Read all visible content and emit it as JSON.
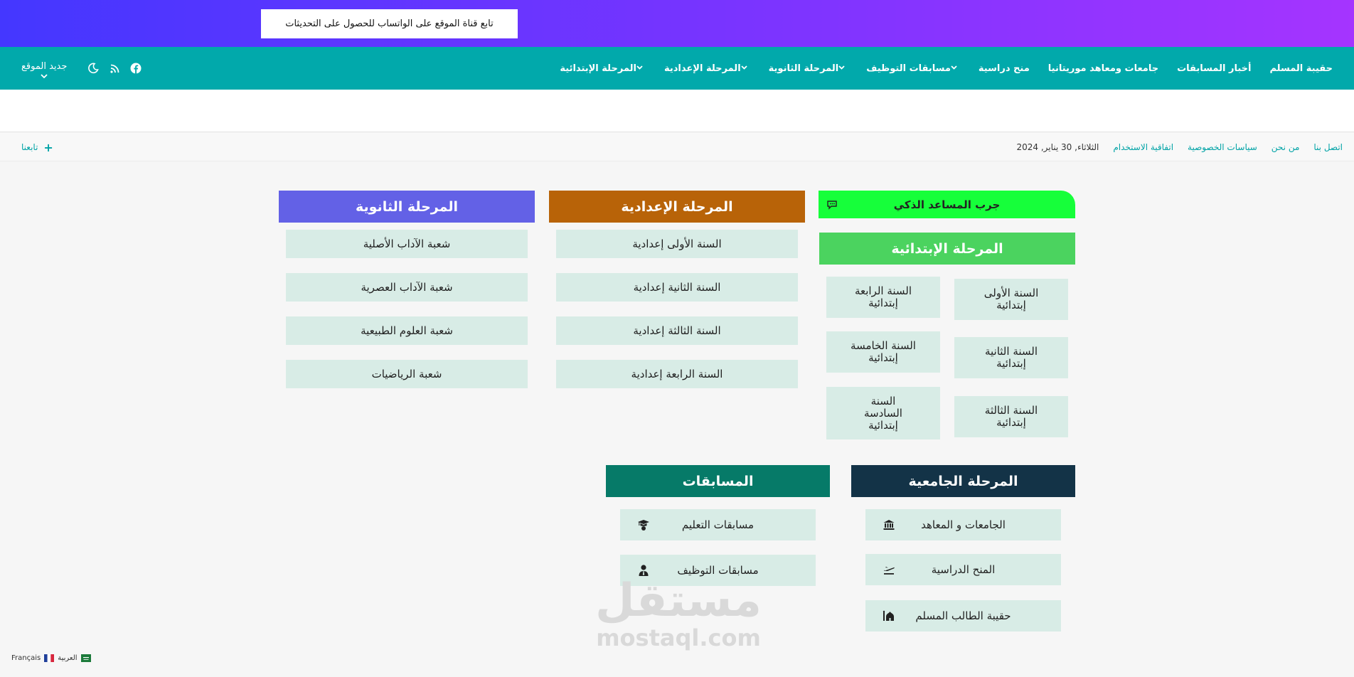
{
  "banner": {
    "whatsapp_label": "تابع قناة الموقع على الواتساب للحصول على التحديثات"
  },
  "nav": {
    "items": [
      {
        "label": "المرحلة الإبتدائية",
        "dropdown": true
      },
      {
        "label": "المرحلة الإعدادية",
        "dropdown": true
      },
      {
        "label": "المرحلة الثانوية",
        "dropdown": true
      },
      {
        "label": "مسابقات التوظيف",
        "dropdown": true
      },
      {
        "label": "منح دراسية",
        "dropdown": false
      },
      {
        "label": "جامعات ومعاهد موريتانيا",
        "dropdown": false
      },
      {
        "label": "أخبار المسابقات",
        "dropdown": false
      },
      {
        "label": "حقيبة المسلم",
        "dropdown": false
      }
    ],
    "site_new": "جديد الموقع",
    "icons": [
      "moon-icon",
      "rss-icon",
      "facebook-icon"
    ]
  },
  "subbar": {
    "date": "الثلاثاء, 30 يناير, 2024",
    "links": [
      "اتفاقية الاستخدام",
      "سياسات الخصوصية",
      "من نحن",
      "اتصل بنا"
    ],
    "follow": "تابعنا"
  },
  "colors": {
    "nav_teal": "#01a9ab",
    "secondary": "#6361e6",
    "middle": "#b86308",
    "primary": "#4bd35f",
    "ai": "#16ff3a",
    "university": "#133347",
    "competitions": "#067a68",
    "button_bg": "#d8ece6"
  },
  "ai_assistant": {
    "label": "جرب المساعد الذكي",
    "icon": "chat-bubble-icon"
  },
  "primary": {
    "title": "المرحلة الإبتدائية",
    "right_col": [
      "السنة الأولى إبتدائية",
      "السنة الثانية إبتدائية",
      "السنة الثالثة إبتدائية"
    ],
    "left_col": [
      "السنة الرابعة إبتدائية",
      "السنة الخامسة إبتدائية",
      "السنة السادسة إبتدائية"
    ]
  },
  "middle": {
    "title": "المرحلة الإعدادية",
    "items": [
      "السنة الأولى إعدادية",
      "السنة الثانية إعدادية",
      "السنة الثالثة إعدادية",
      "السنة الرابعة إعدادية"
    ]
  },
  "secondary": {
    "title": "المرحلة الثانوية",
    "items": [
      "شعبة الآداب الأصلية",
      "شعبة الآداب العصرية",
      "شعبة العلوم الطبيعية",
      "شعبة الرياضيات"
    ]
  },
  "university": {
    "title": "المرحلة الجامعية",
    "items": [
      {
        "label": "الجامعات و المعاهد",
        "icon": "university-icon"
      },
      {
        "label": "المنح الدراسية",
        "icon": "plane-icon"
      },
      {
        "label": "حقيبة الطالب المسلم",
        "icon": "mosque-icon"
      }
    ]
  },
  "competitions": {
    "title": "المسابقات",
    "items": [
      {
        "label": "مسابقات التعليم",
        "icon": "graduation-cap-icon"
      },
      {
        "label": "مسابقات التوظيف",
        "icon": "user-tie-icon"
      }
    ]
  },
  "watermark": {
    "arabic": "مستقل",
    "latin": "mostaql.com"
  },
  "languages": [
    {
      "label": "Français",
      "flag": "france-flag-icon"
    },
    {
      "label": "العربية",
      "flag": "saudi-flag-icon"
    }
  ]
}
